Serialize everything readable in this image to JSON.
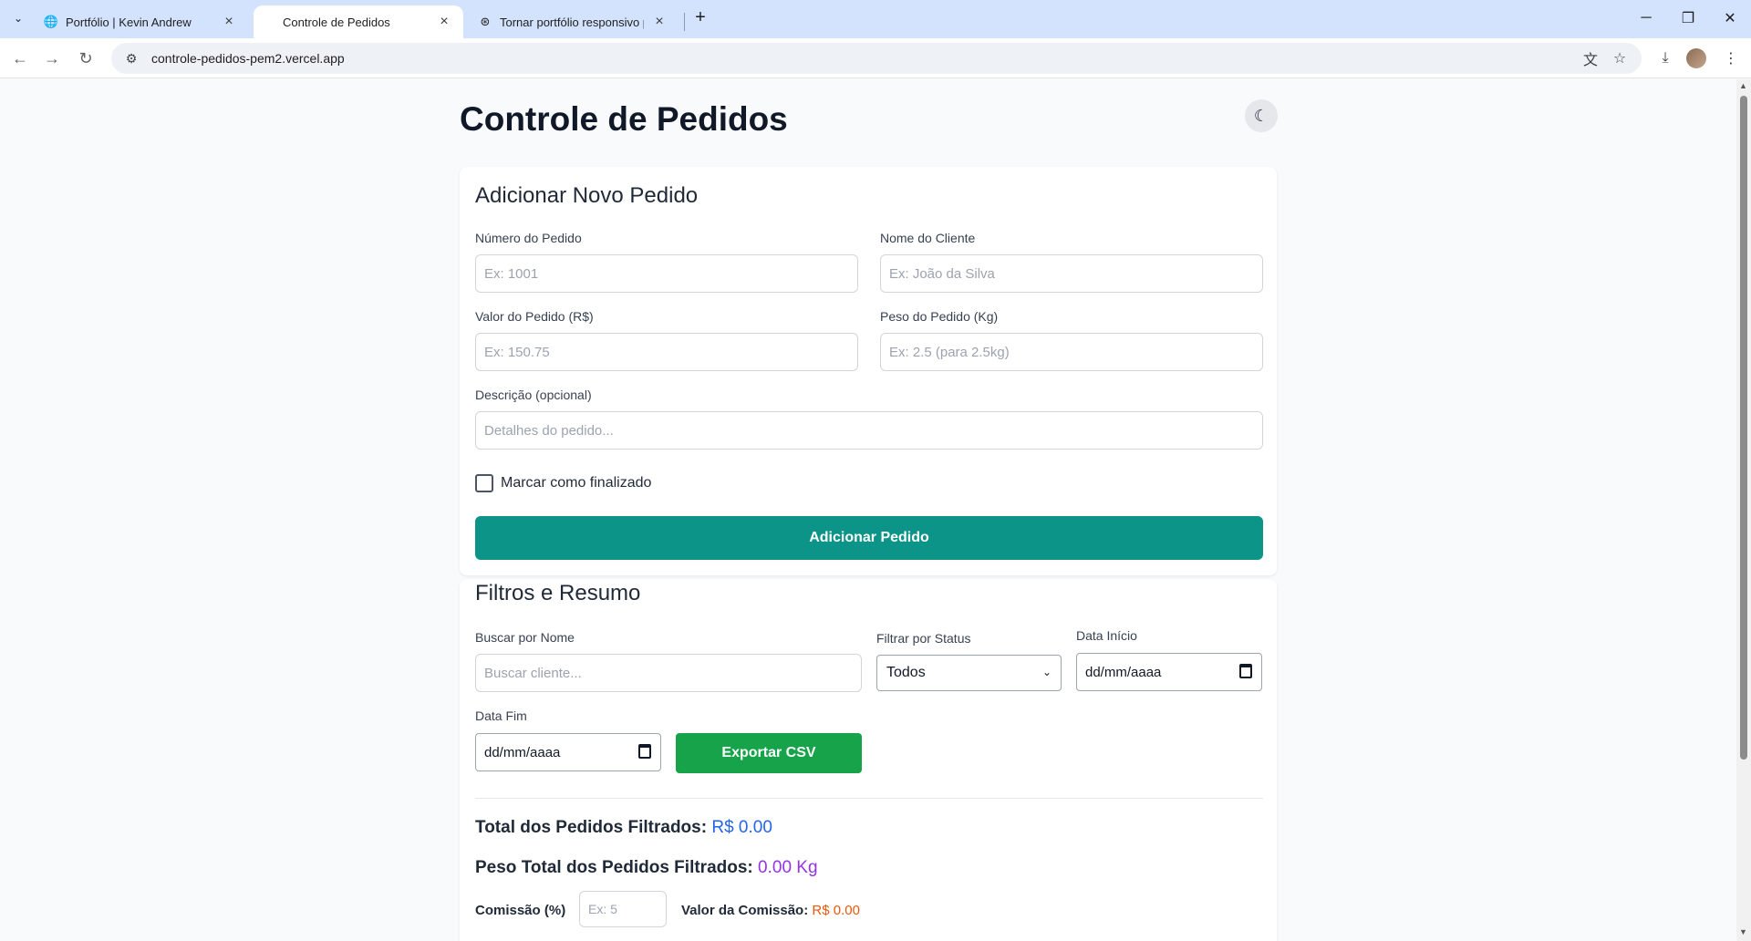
{
  "browser": {
    "tabs": [
      {
        "title": "Portfólio | Kevin Andrew",
        "active": false
      },
      {
        "title": "Controle de Pedidos",
        "active": true
      },
      {
        "title": "Tornar portfólio responsivo par",
        "active": false
      }
    ],
    "url": "controle-pedidos-pem2.vercel.app"
  },
  "page": {
    "title": "Controle de Pedidos"
  },
  "add_form": {
    "title": "Adicionar Novo Pedido",
    "order_number_label": "Número do Pedido",
    "order_number_placeholder": "Ex: 1001",
    "client_name_label": "Nome do Cliente",
    "client_name_placeholder": "Ex: João da Silva",
    "value_label": "Valor do Pedido (R$)",
    "value_placeholder": "Ex: 150.75",
    "weight_label": "Peso do Pedido (Kg)",
    "weight_placeholder": "Ex: 2.5 (para 2.5kg)",
    "description_label": "Descrição (opcional)",
    "description_placeholder": "Detalhes do pedido...",
    "finished_checkbox_label": "Marcar como finalizado",
    "finished_checked": false,
    "submit_label": "Adicionar Pedido"
  },
  "filters": {
    "title": "Filtros e Resumo",
    "search_label": "Buscar por Nome",
    "search_placeholder": "Buscar cliente...",
    "status_label": "Filtrar por Status",
    "status_value": "Todos",
    "start_date_label": "Data Início",
    "start_date_value": "dd/mm/aaaa",
    "end_date_label": "Data Fim",
    "end_date_value": "dd/mm/aaaa",
    "export_label": "Exportar CSV"
  },
  "summary": {
    "total_label": "Total dos Pedidos Filtrados:",
    "total_value": "R$ 0.00",
    "weight_label": "Peso Total dos Pedidos Filtrados:",
    "weight_value": "0.00 Kg",
    "commission_label": "Comissão (%)",
    "commission_placeholder": "Ex: 5",
    "commission_value_label": "Valor da Comissão:",
    "commission_value": "R$ 0.00"
  },
  "colors": {
    "primary_button": "#0d9488",
    "export_button": "#16a34a",
    "total_value": "#2563eb",
    "weight_value": "#9333ea",
    "commission_value": "#ea580c"
  }
}
